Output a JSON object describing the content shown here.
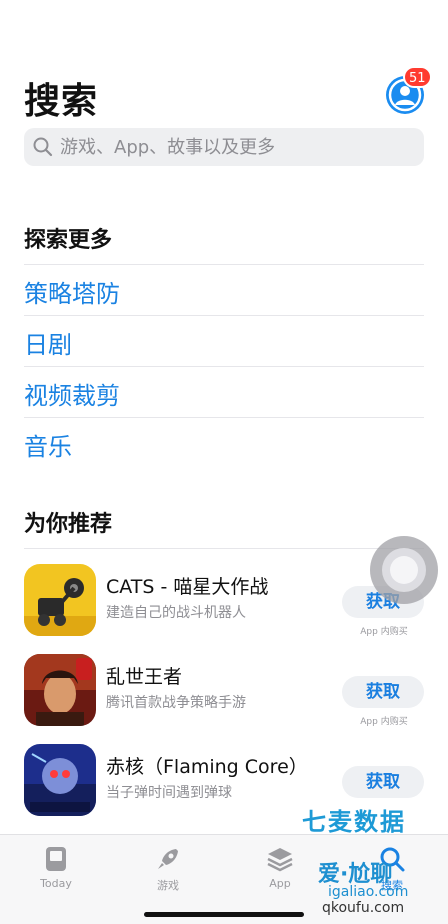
{
  "header": {
    "title": "搜索",
    "badge_count": "51"
  },
  "search": {
    "placeholder": "游戏、App、故事以及更多"
  },
  "discover": {
    "title": "探索更多",
    "items": [
      "策略塔防",
      "日剧",
      "视频裁剪",
      "音乐"
    ]
  },
  "recommend": {
    "title": "为你推荐",
    "apps": [
      {
        "name": "CATS - 喵星大作战",
        "subtitle": "建造自己的战斗机器人",
        "button": "获取",
        "note": "App 内购买"
      },
      {
        "name": "乱世王者",
        "subtitle": "腾讯首款战争策略手游",
        "button": "获取",
        "note": "App 内购买"
      },
      {
        "name": "赤核（Flaming Core）",
        "subtitle": "当子弹时间遇到弹球",
        "button": "获取",
        "note": ""
      }
    ]
  },
  "tabbar": {
    "tabs": [
      "Today",
      "游戏",
      "App",
      "搜索"
    ]
  },
  "watermark": {
    "line1": "七麦数据",
    "line2": "爱·尬聊",
    "line3": "igaliao.com",
    "line4": "qkoufu.com"
  },
  "colors": {
    "accent": "#1a82e2",
    "badge": "#ff3b30"
  }
}
